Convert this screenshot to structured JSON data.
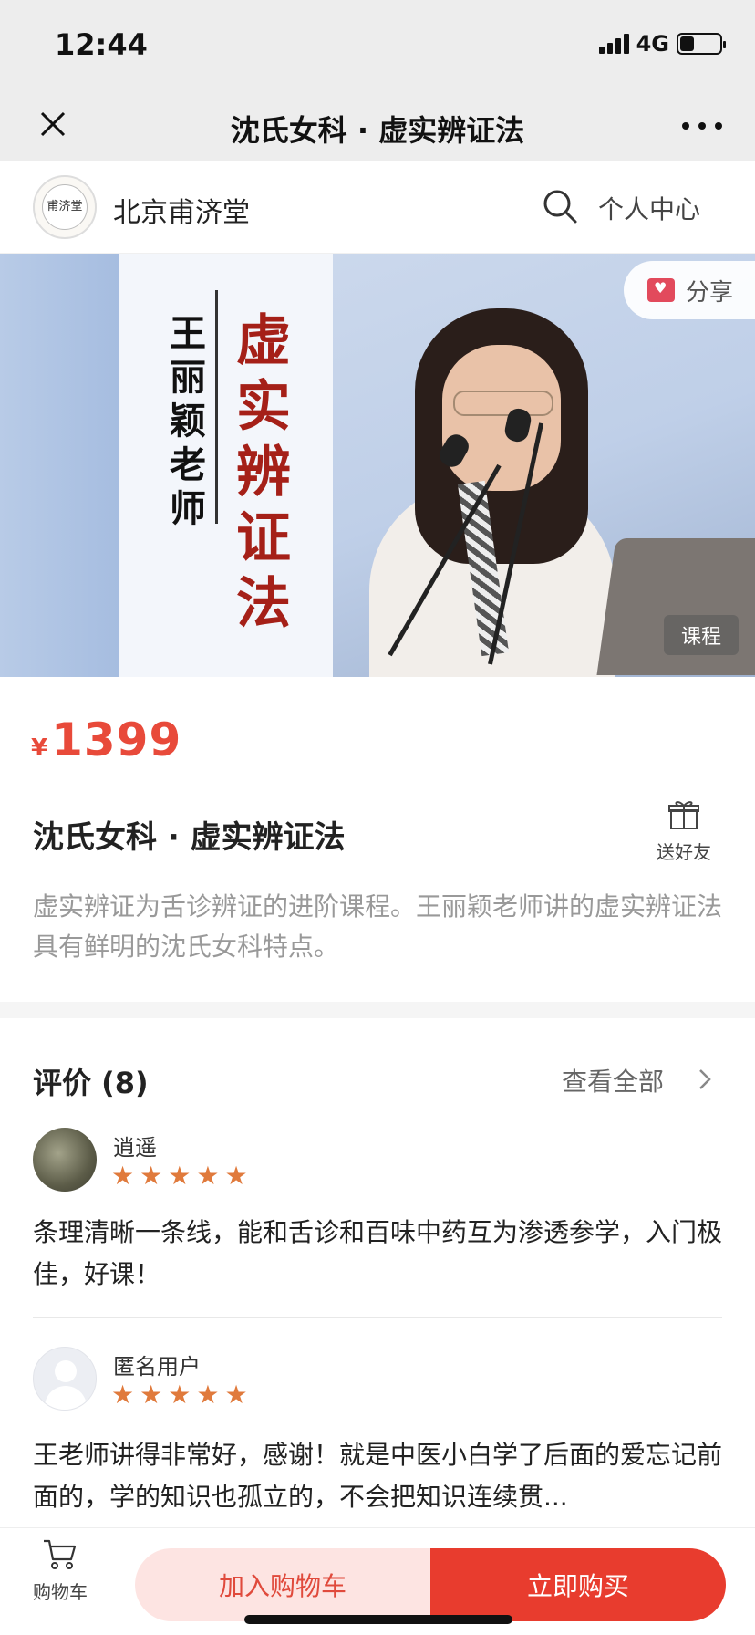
{
  "status_bar": {
    "time": "12:44",
    "network": "4G",
    "battery_level": 0.35
  },
  "nav": {
    "title": "沈氏女科 · 虚实辨证法",
    "close_icon": "close-icon",
    "more_icon": "more-dots-icon"
  },
  "shop": {
    "logo_text": "甫济堂",
    "name": "北京甫济堂",
    "search_icon": "search-icon",
    "profile_label": "个人中心"
  },
  "banner": {
    "teacher": "王丽颖老师",
    "course_title_vertical": "虚实辨证法",
    "share_label": "分享",
    "type_badge": "课程"
  },
  "product": {
    "currency": "¥",
    "price": "1399",
    "title": "沈氏女科 · 虚实辨证法",
    "gift_label": "送好友",
    "description": "虚实辨证为舌诊辨证的进阶课程。王丽颖老师讲的虚实辨证法具有鲜明的沈氏女科特点。",
    "accent_color": "#e84a3a"
  },
  "reviews": {
    "title": "评价 (8)",
    "view_all": "查看全部",
    "items": [
      {
        "user": "逍遥",
        "rating": 5,
        "text": "条理清晰一条线，能和舌诊和百味中药互为渗透参学，入门极佳，好课！"
      },
      {
        "user": "匿名用户",
        "rating": 5,
        "text": "王老师讲得非常好，感谢！就是中医小白学了后面的爱忘记前面的，学的知识也孤立的，不会把知识连续贯..."
      }
    ]
  },
  "bottom_bar": {
    "cart_label": "购物车",
    "add_to_cart": "加入购物车",
    "buy_now": "立即购买",
    "buy_color": "#e83c2e"
  }
}
